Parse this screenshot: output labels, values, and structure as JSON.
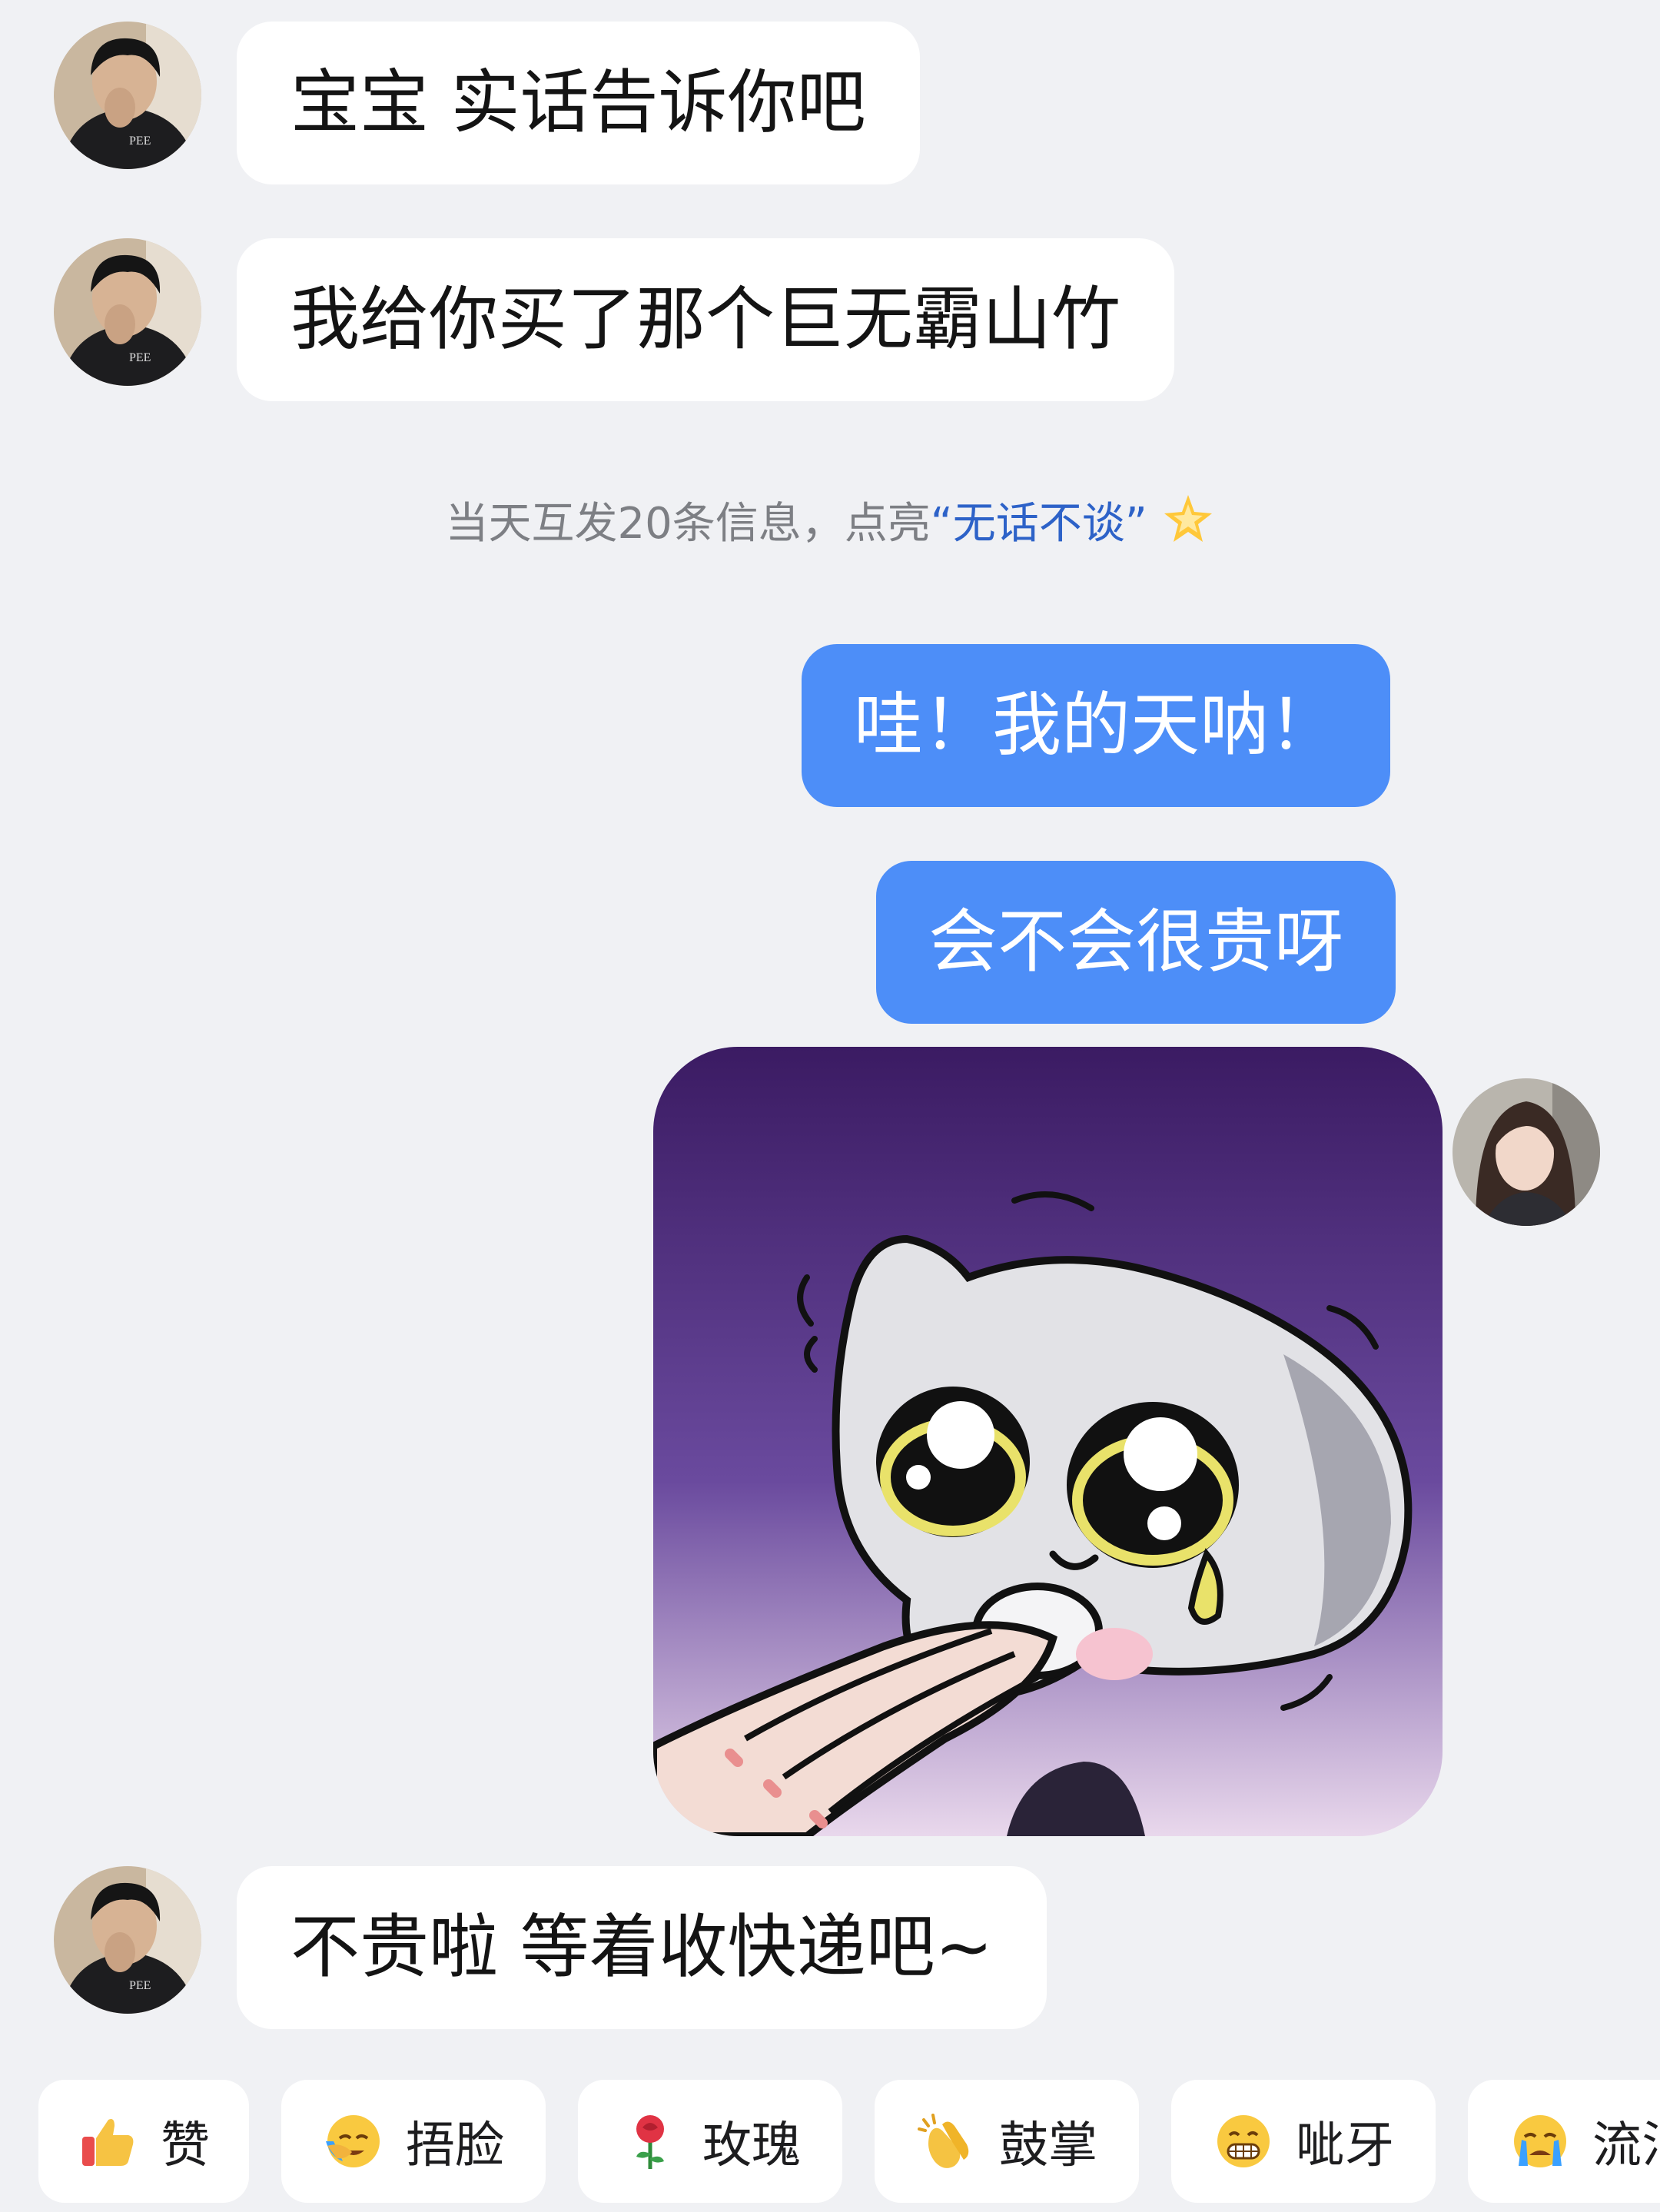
{
  "messages": [
    {
      "side": "in",
      "text": "宝宝 实话告诉你吧"
    },
    {
      "side": "in",
      "text": "我给你买了那个巨无霸山竹"
    },
    {
      "side": "out",
      "text": "哇！我的天呐！"
    },
    {
      "side": "out",
      "text": "会不会很贵呀"
    },
    {
      "side": "out",
      "type": "sticker",
      "sticker": "crying-cat-sticker"
    },
    {
      "side": "in",
      "text": "不贵啦 等着收快递吧~"
    }
  ],
  "system_note": {
    "prefix": "当天互发20条信息，点亮",
    "highlight": "“无话不谈”",
    "icon": "sparkle-star-icon"
  },
  "reactions": [
    {
      "icon": "thumbs-up-icon",
      "label": "赞"
    },
    {
      "icon": "facepalm-icon",
      "label": "捂脸"
    },
    {
      "icon": "rose-icon",
      "label": "玫瑰"
    },
    {
      "icon": "clapping-hands-icon",
      "label": "鼓掌"
    },
    {
      "icon": "grin-icon",
      "label": "呲牙"
    },
    {
      "icon": "crying-face-icon",
      "label": "流泪"
    }
  ],
  "colors": {
    "background": "#f0f1f4",
    "incoming_bubble": "#ffffff",
    "outgoing_bubble": "#4d8ef8",
    "highlight_text": "#2d62c8"
  }
}
